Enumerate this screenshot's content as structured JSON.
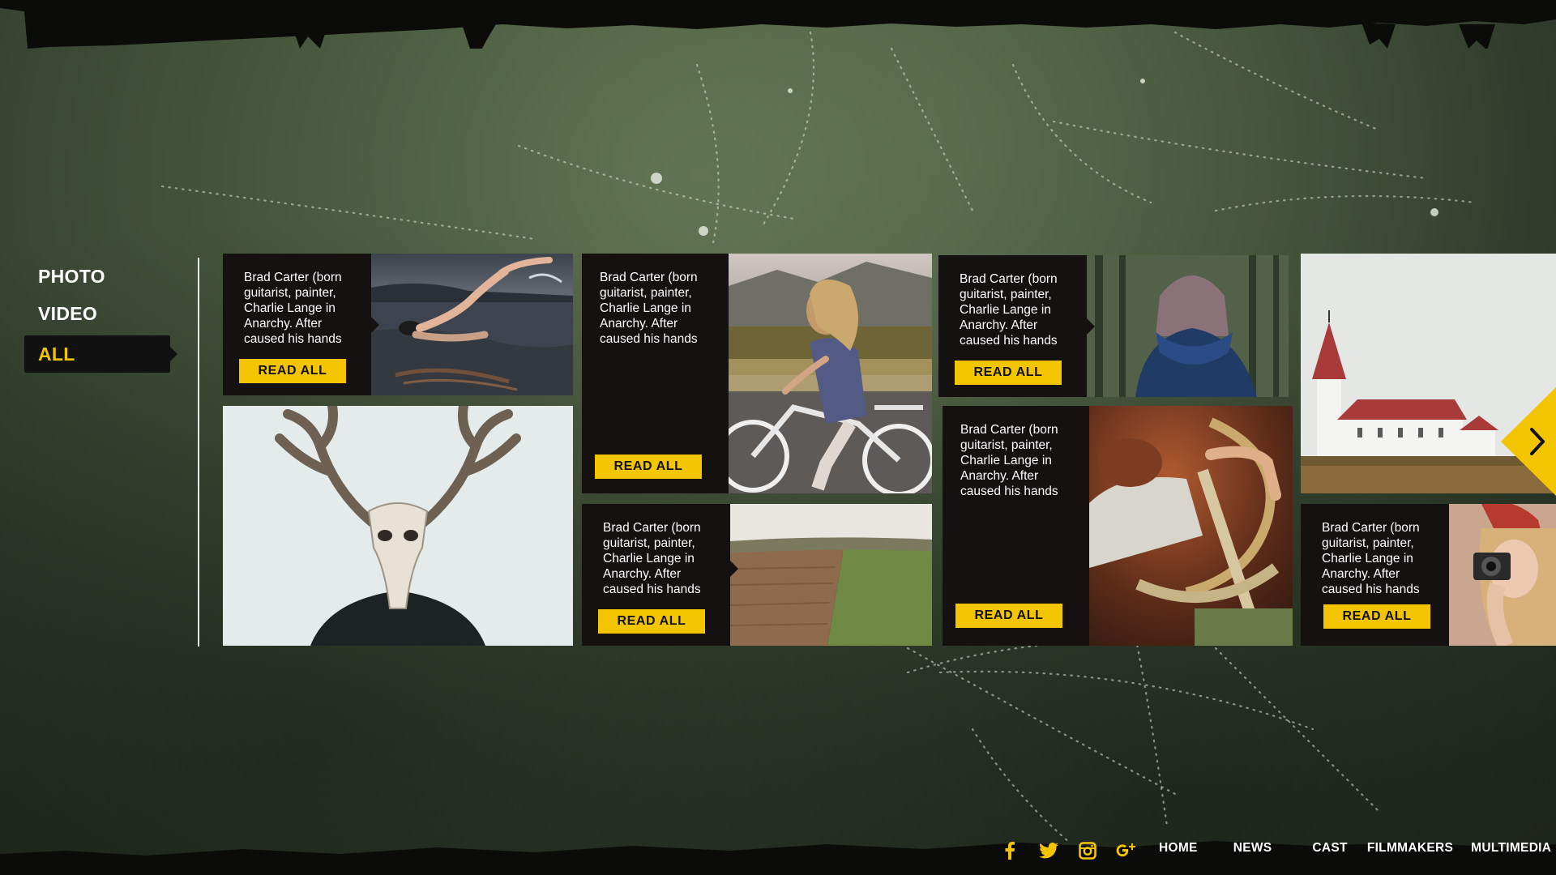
{
  "side_nav": {
    "items": [
      {
        "label": "PHOTO",
        "active": false
      },
      {
        "label": "VIDEO",
        "active": false
      },
      {
        "label": "ALL",
        "active": true
      }
    ]
  },
  "cards": [
    {
      "id": "swimmer",
      "text": "Brad Carter (born guitarist, painter, Charlie Lange in Anarchy.  After caused his hands",
      "button": "READ ALL",
      "photo": "swimmer"
    },
    {
      "id": "skull",
      "text": "",
      "button": "",
      "photo": "deer-skull"
    },
    {
      "id": "bike",
      "text": "Brad Carter (born guitarist, painter, Charlie Lange in Anarchy.  After caused his hands",
      "button": "READ ALL",
      "photo": "girl-on-bike"
    },
    {
      "id": "field",
      "text": "Brad Carter (born guitarist, painter, Charlie Lange in Anarchy.  After caused his hands",
      "button": "READ ALL",
      "photo": "plowed-field"
    },
    {
      "id": "hood",
      "text": "Brad Carter (born guitarist, painter, Charlie Lange in Anarchy.  After caused his hands",
      "button": "READ ALL",
      "photo": "blue-hood"
    },
    {
      "id": "steering",
      "text": "Brad Carter (born guitarist, painter, Charlie Lange in Anarchy.  After caused his hands",
      "button": "READ ALL",
      "photo": "steering-wheel"
    },
    {
      "id": "church",
      "text": "",
      "button": "",
      "photo": "church"
    },
    {
      "id": "camera",
      "text": "Brad Carter (born guitarist, painter, Charlie Lange in Anarchy.  After caused his hands",
      "button": "READ ALL",
      "photo": "camera-girl"
    }
  ],
  "next_arrow": "chevron-right-icon",
  "social": [
    "facebook-icon",
    "twitter-icon",
    "instagram-icon",
    "google-plus-icon"
  ],
  "footer_nav": {
    "items": [
      "HOME",
      "NEWS",
      "CAST",
      "FILMMAKERS",
      "MULTIMEDIA"
    ]
  },
  "colors": {
    "accent": "#f3c400",
    "panel": "#141110",
    "text": "#ffffff"
  }
}
